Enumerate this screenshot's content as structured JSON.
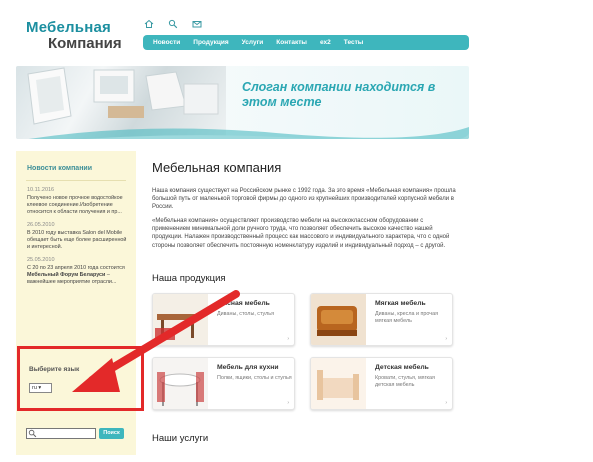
{
  "logo": {
    "line1": "Мебельная",
    "line2": "Компания"
  },
  "top_icons": [
    "home-icon",
    "search-icon",
    "mail-icon"
  ],
  "nav": [
    "Новости",
    "Продукция",
    "Услуги",
    "Контакты",
    "ex2",
    "Тесты"
  ],
  "banner": {
    "slogan": "Слоган компании находится в этом месте"
  },
  "sidebar": {
    "news_title": "Новости компании",
    "news": [
      {
        "date": "10.11.2016",
        "text": "Получено новое прочное водостойкое клеевое соединение.Изобретение относится к области получения и пр..."
      },
      {
        "date": "26.05.2010",
        "text": "В 2010 году выставка Salon del Mobile обещает быть еще более расширенной и интересной."
      },
      {
        "date": "25.05.2010",
        "text_pre": "С 20 по 23 апреля 2010 года состоится ",
        "text_bold": "Мебельный Форум Беларуси",
        "text_post": " – важнейшее мероприятие отрасли..."
      }
    ],
    "lang_title": "Выберите язык",
    "lang_value": "ru",
    "search_button": "Поиск"
  },
  "main": {
    "title": "Мебельная компания",
    "para1": "Наша компания существует на Российском рынке с 1992 года. За это время «Мебельная компания» прошла большой путь от маленькой торговой фирмы до одного из крупнейших производителей корпусной мебели в России.",
    "para2": "«Мебельная компания» осуществляет производство мебели на высококлассном оборудовании с применением минимальной доли ручного труда, что позволяет обеспечить высокое качество нашей продукции. Налажен производственный процесс как массового и индивидуального характера, что с одной стороны позволяет обеспечить постоянную номенклатуру изделий и индивидуальный подход – с другой.",
    "products_title": "Наша продукция",
    "services_title": "Наши услуги",
    "products": [
      {
        "title": "фисная мебель",
        "desc": "Диваны, столы, стулья"
      },
      {
        "title": "Мягкая мебель",
        "desc": "Диваны, кресла и прочая мягкая мебель"
      },
      {
        "title": "Мебель для кухни",
        "desc": "Полки, ящики, столы и стулья"
      },
      {
        "title": "Детская мебель",
        "desc": "Кровати, стулья, мягкая детская мебель"
      }
    ]
  },
  "colors": {
    "accent": "#3eb6bd",
    "sidebar_bg": "#fbf7d9",
    "highlight": "#e32929"
  }
}
